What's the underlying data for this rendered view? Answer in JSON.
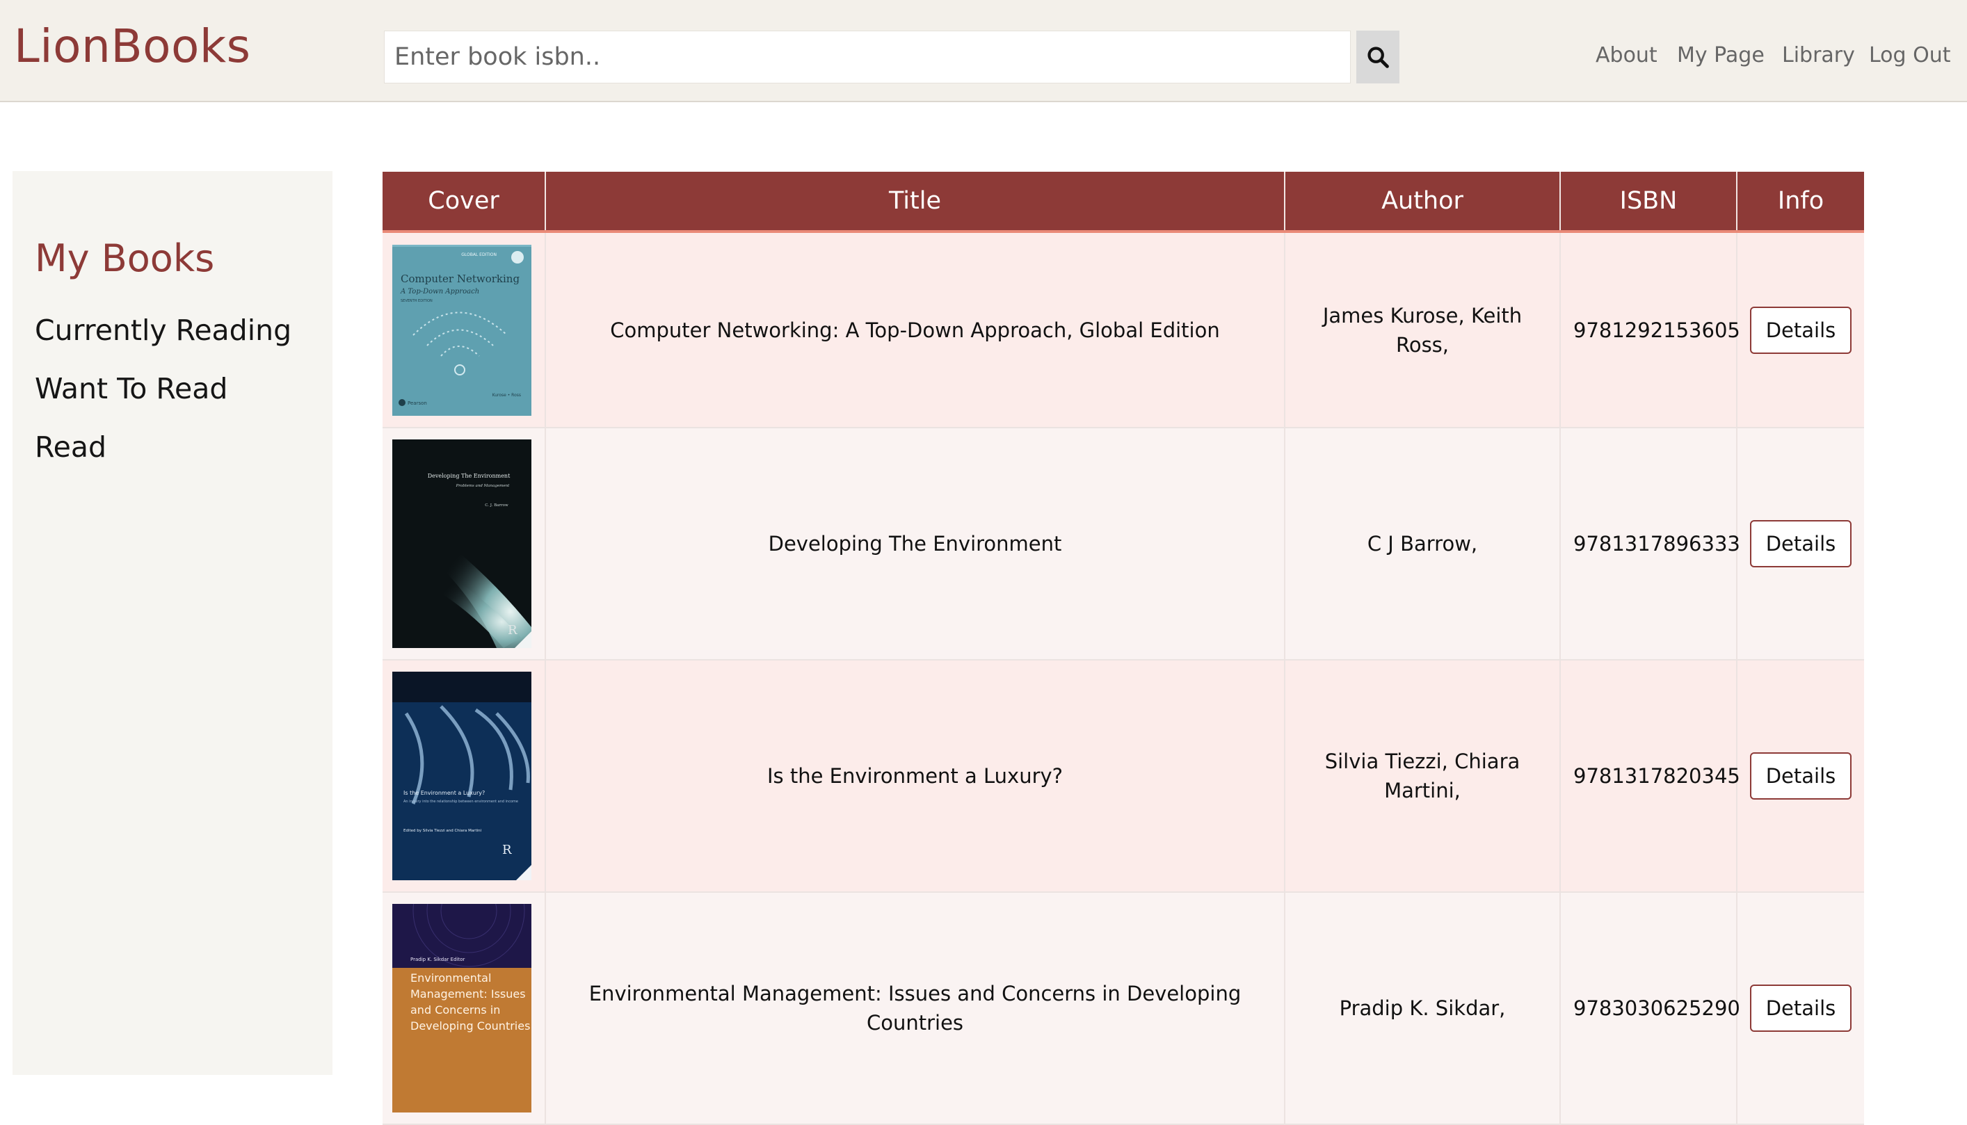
{
  "header": {
    "logo": "LionBooks",
    "search_placeholder": "Enter book isbn..",
    "search_icon": "search-icon",
    "nav": [
      "About",
      "My Page",
      "Library",
      "Log Out"
    ]
  },
  "sidebar": {
    "title": "My Books",
    "items": [
      "Currently Reading",
      "Want To Read",
      "Read"
    ]
  },
  "table": {
    "columns": [
      "Cover",
      "Title",
      "Author",
      "ISBN",
      "Info"
    ],
    "rows": [
      {
        "title": "Computer Networking: A Top-Down Approach, Global Edition",
        "author": "James Kurose, Keith Ross,",
        "isbn": "9781292153605",
        "action": "Details",
        "cover": {
          "bg": "#5fa0b0",
          "edition_label": "GLOBAL EDITION",
          "title": "Computer Networking",
          "subtitle": "A Top-Down Approach",
          "extra": "SEVENTH EDITION",
          "author": "Kurose • Ross",
          "publisher": "Pearson"
        }
      },
      {
        "title": "Developing The Environment",
        "author": "C J Barrow,",
        "isbn": "9781317896333",
        "action": "Details",
        "cover": {
          "bg": "#0c1214",
          "title": "Developing The Environment",
          "subtitle": "Problems and Management",
          "author": "C. J. Barrow",
          "publisher": "R"
        }
      },
      {
        "title": "Is the Environment a Luxury?",
        "author": "Silvia Tiezzi, Chiara Martini,",
        "isbn": "9781317820345",
        "action": "Details",
        "cover": {
          "bg": "#0d2f57",
          "title": "Is the Environment a Luxury?",
          "subtitle": "An inquiry into the relationship between environment and income",
          "editors": "Edited by Silvia Tiezzi and Chiara Martini",
          "publisher": "R"
        }
      },
      {
        "title": "Environmental Management: Issues and Concerns in Developing Countries",
        "author": "Pradip K. Sikdar,",
        "isbn": "9783030625290",
        "action": "Details",
        "cover": {
          "bg": "#c07a33",
          "editor": "Pradip K. Sikdar  Editor",
          "title_lines": [
            "Environmental",
            "Management: Issues",
            "and Concerns in",
            "Developing Countries"
          ]
        }
      }
    ]
  }
}
